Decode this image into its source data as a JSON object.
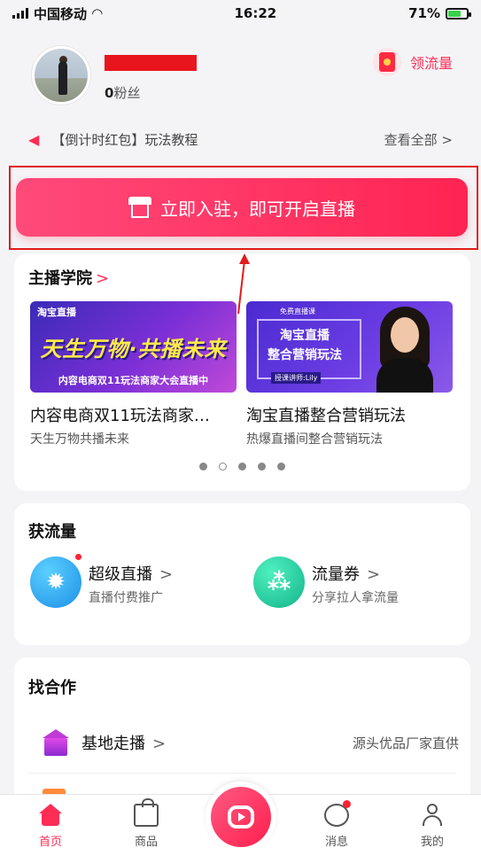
{
  "status_bar": {
    "carrier": "中国移动",
    "time": "16:22",
    "battery": "71%",
    "battery_level": 0.71
  },
  "profile": {
    "fans_count": "0",
    "fans_label": "粉丝",
    "flow_link": "领流量"
  },
  "notice": {
    "text": "【倒计时红包】玩法教程",
    "more": "查看全部 >"
  },
  "cta": {
    "label": "立即入驻，即可开启直播"
  },
  "academy": {
    "title": "主播学院",
    "chevron": ">",
    "courses": [
      {
        "title": "内容电商双11玩法商家大会直播中",
        "display_title": "内容电商双11玩法商家…",
        "subtitle": "天生万物共播未来",
        "thumb_logo": "淘宝直播",
        "thumb_headline": "天生万物·共播未来",
        "thumb_caption": "内容电商双11玩法商家大会直播中"
      },
      {
        "title": "淘宝直播整合营销玩法",
        "display_title": "淘宝直播整合营销玩法",
        "subtitle": "热爆直播间整合营销玩法",
        "thumb_tag": "免费直播课",
        "thumb_line1": "淘宝直播",
        "thumb_line2": "整合营销玩法",
        "thumb_speaker": "授课讲师:Lily"
      }
    ],
    "pagination": {
      "total": 5,
      "current": 2
    }
  },
  "traffic": {
    "title": "获流量",
    "tools": [
      {
        "name": "超级直播",
        "chevron": ">",
        "desc": "直播付费推广",
        "icon": "gear-icon",
        "color": "#1d8fe6",
        "badge": true
      },
      {
        "name": "流量券",
        "chevron": ">",
        "desc": "分享拉人拿流量",
        "icon": "share-icon",
        "color": "#13b48a",
        "badge": false
      }
    ]
  },
  "cooperation": {
    "title": "找合作",
    "rows": [
      {
        "name": "基地走播",
        "chevron": ">",
        "desc": "源头优品厂家直供",
        "icon": "building-icon"
      }
    ]
  },
  "tabbar": {
    "home": "首页",
    "goods": "商品",
    "messages": "消息",
    "mine": "我的"
  },
  "colors": {
    "accent": "#ff2d55",
    "annotation_red": "#e21b1b"
  }
}
